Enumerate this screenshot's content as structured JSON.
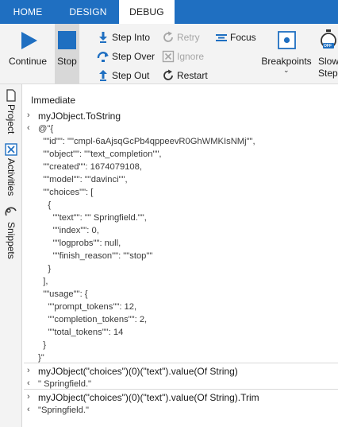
{
  "tabs": [
    {
      "label": "HOME",
      "active": false
    },
    {
      "label": "DESIGN",
      "active": false
    },
    {
      "label": "DEBUG",
      "active": true
    }
  ],
  "ribbon": {
    "continue_label": "Continue",
    "stop_label": "Stop",
    "step_into_label": "Step Into",
    "step_over_label": "Step Over",
    "step_out_label": "Step Out",
    "retry_label": "Retry",
    "ignore_label": "Ignore",
    "restart_label": "Restart",
    "focus_label": "Focus",
    "breakpoints_label": "Breakpoints",
    "slow_step_label": "Slow Step",
    "slow_step_badge": "OFF"
  },
  "side_tabs": [
    {
      "label": "Project"
    },
    {
      "label": "Activities"
    },
    {
      "label": "Snippets"
    }
  ],
  "immediate": {
    "title": "Immediate",
    "entries": [
      {
        "kind": "cmd",
        "text": "myJObject.ToString"
      },
      {
        "kind": "out",
        "text": "@\"{"
      },
      {
        "kind": "out",
        "text": "  \"\"id\"\": \"\"cmpl-6aAjsqGcPb4qppeevR0GhWMKIsNMj\"\","
      },
      {
        "kind": "out",
        "text": "  \"\"object\"\": \"\"text_completion\"\","
      },
      {
        "kind": "out",
        "text": "  \"\"created\"\": 1674079108,"
      },
      {
        "kind": "out",
        "text": "  \"\"model\"\": \"\"davinci\"\","
      },
      {
        "kind": "out",
        "text": "  \"\"choices\"\": ["
      },
      {
        "kind": "out",
        "text": "    {"
      },
      {
        "kind": "out",
        "text": "      \"\"text\"\": \"\" Springfield.\"\","
      },
      {
        "kind": "out",
        "text": "      \"\"index\"\": 0,"
      },
      {
        "kind": "out",
        "text": "      \"\"logprobs\"\": null,"
      },
      {
        "kind": "out",
        "text": "      \"\"finish_reason\"\": \"\"stop\"\""
      },
      {
        "kind": "out",
        "text": "    }"
      },
      {
        "kind": "out",
        "text": "  ],"
      },
      {
        "kind": "out",
        "text": "  \"\"usage\"\": {"
      },
      {
        "kind": "out",
        "text": "    \"\"prompt_tokens\"\": 12,"
      },
      {
        "kind": "out",
        "text": "    \"\"completion_tokens\"\": 2,"
      },
      {
        "kind": "out",
        "text": "    \"\"total_tokens\"\": 14"
      },
      {
        "kind": "out",
        "text": "  }"
      },
      {
        "kind": "out",
        "text": "}\""
      },
      {
        "kind": "cmd",
        "text": "myJObject(\"choices\")(0)(\"text\").value(Of String)"
      },
      {
        "kind": "out",
        "text": "\" Springfield.\""
      },
      {
        "kind": "cmd",
        "text": "myJObject(\"choices\")(0)(\"text\").value(Of String).Trim"
      },
      {
        "kind": "out",
        "text": "\"Springfield.\""
      }
    ]
  },
  "colors": {
    "tab_bar": "#1f6fc1",
    "accent_blue": "#1f6fc1",
    "ribbon_bg": "#f3f3f3",
    "pressed_bg": "#d8d8d8"
  }
}
